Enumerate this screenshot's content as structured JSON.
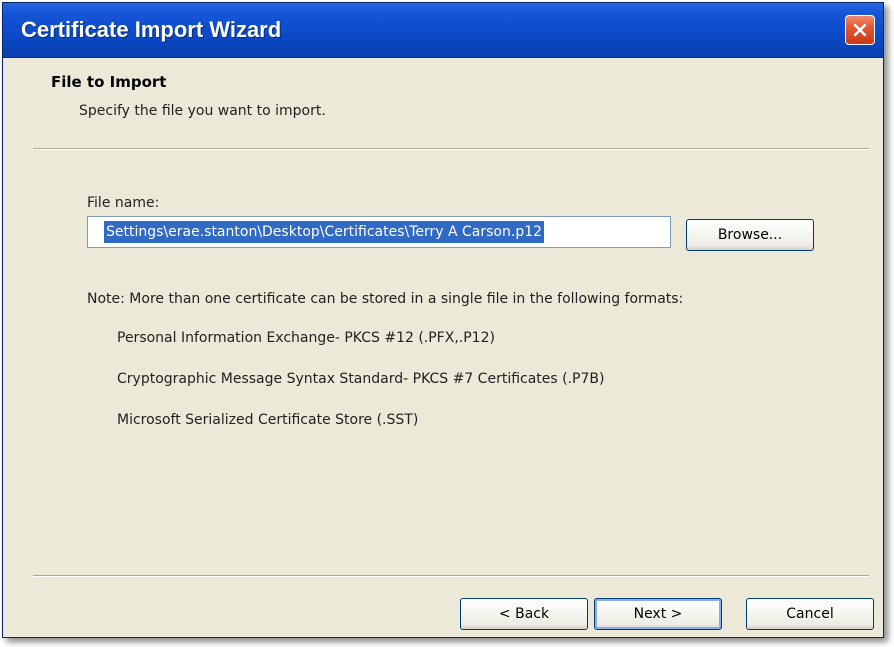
{
  "window": {
    "title": "Certificate Import Wizard"
  },
  "header": {
    "title": "File to Import",
    "subtitle": "Specify the file you want to import."
  },
  "file": {
    "label": "File name:",
    "value": "Settings\\erae.stanton\\Desktop\\Certificates\\Terry A Carson.p12",
    "browse_label": "Browse..."
  },
  "note": {
    "text": "Note:  More than one certificate can be stored in a single file in the following formats:",
    "formats": [
      "Personal Information Exchange- PKCS #12 (.PFX,.P12)",
      "Cryptographic Message Syntax Standard- PKCS #7 Certificates (.P7B)",
      "Microsoft Serialized Certificate Store (.SST)"
    ]
  },
  "footer": {
    "back_label": "< Back",
    "next_label": "Next >",
    "cancel_label": "Cancel"
  },
  "colors": {
    "titlebar": "#0d4ccc",
    "window_bg": "#ece9d8",
    "selection": "#316ac5",
    "close_button": "#e0532f"
  },
  "icons": {
    "close": "close-icon"
  }
}
